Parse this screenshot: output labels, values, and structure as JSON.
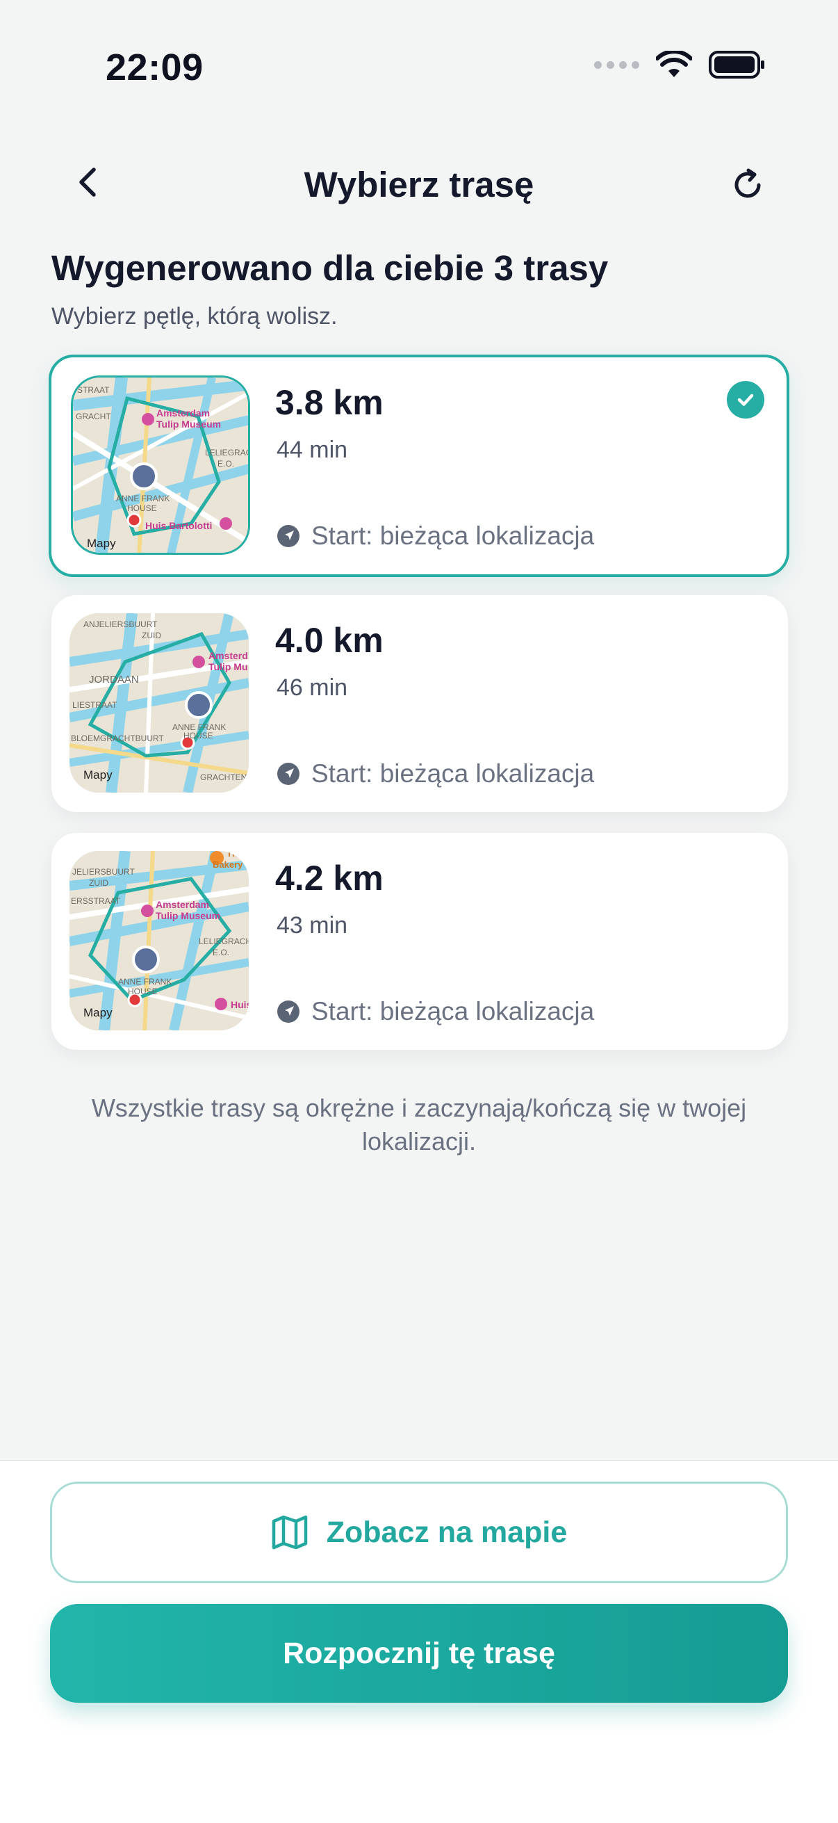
{
  "status_bar": {
    "time": "22:09"
  },
  "nav": {
    "title": "Wybierz trasę"
  },
  "heading": "Wygenerowano dla ciebie 3 trasy",
  "subheading": "Wybierz pętlę, którą wolisz.",
  "routes": [
    {
      "distance": "3.8 km",
      "duration": "44 min",
      "start": "Start: bieżąca lokalizacja",
      "selected": true,
      "map_labels": [
        "STRAAT",
        "GRACHT",
        "Amsterdam",
        "Tulip Museum",
        "LELIEGRACH",
        "E.O.",
        "ANNE FRANK",
        "HOUSE",
        "Huis Bartolotti",
        "Mapy"
      ]
    },
    {
      "distance": "4.0 km",
      "duration": "46 min",
      "start": "Start: bieżąca lokalizacja",
      "selected": false,
      "map_labels": [
        "ANJELIERSBUURT",
        "ZUID",
        "JORDAAN",
        "LIESTRAAT",
        "BLOEMGRACHTBUURT",
        "Amsterd",
        "Tulip Mu",
        "ANNE FRANK",
        "HOUSE",
        "GRACHTEN",
        "Mapy"
      ]
    },
    {
      "distance": "4.2 km",
      "duration": "43 min",
      "start": "Start: bieżąca lokalizacja",
      "selected": false,
      "map_labels": [
        "JELIERSBUURT",
        "ZUID",
        "ERSSTRAAT",
        "The",
        "Bakery",
        "Amsterdam",
        "Tulip Museum",
        "LELIEGRACH",
        "E.O.",
        "ANNE FRANK",
        "HOUSE",
        "Huis",
        "Mapy"
      ]
    }
  ],
  "footnote": "Wszystkie trasy są okrężne i zaczynają/kończą się w twojej lokalizacji.",
  "buttons": {
    "map": "Zobacz na mapie",
    "start": "Rozpocznij tę trasę"
  },
  "colors": {
    "accent": "#26aea5",
    "accent_dark": "#159c93",
    "map_water": "#8fd3ea",
    "map_land": "#e9e4d6",
    "poi_pink": "#d44f9d",
    "pin_red": "#e23a3a"
  },
  "icons": {
    "back": "chevron-left-icon",
    "refresh": "refresh-icon",
    "check": "checkmark-icon",
    "location": "location-arrow-icon",
    "map": "map-icon"
  }
}
